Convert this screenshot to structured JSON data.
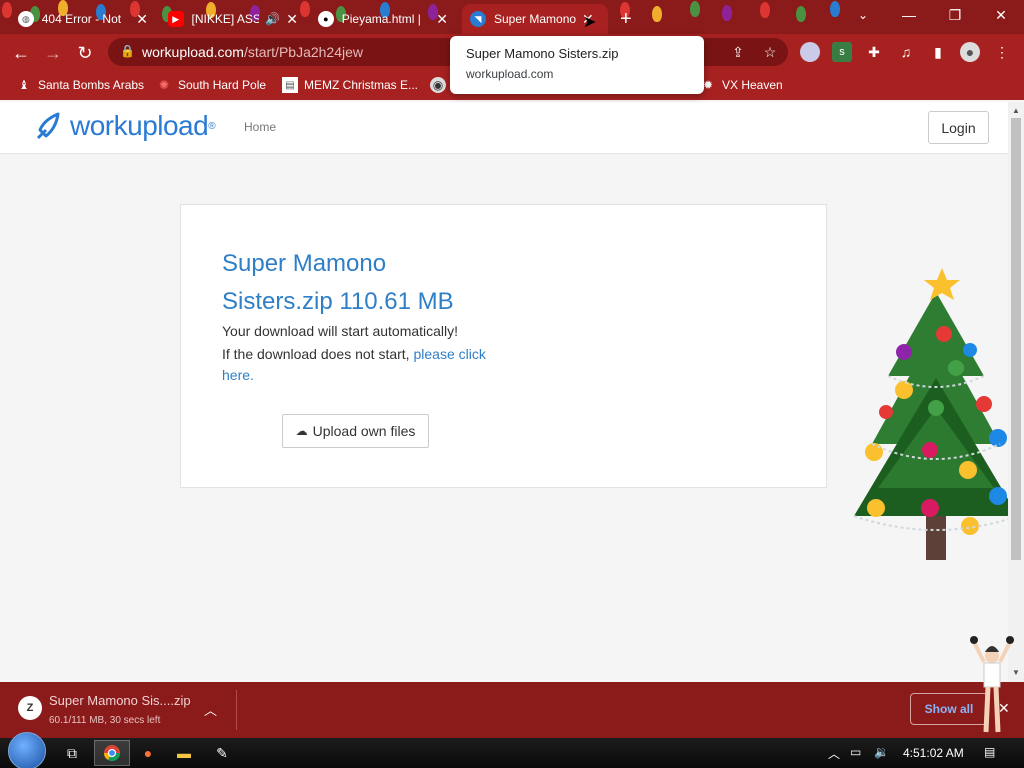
{
  "browser": {
    "tabs": [
      {
        "title": "404 Error - Not",
        "favicon": "chrome-globe-icon"
      },
      {
        "title": "[NIKKE] ASS",
        "favicon": "youtube-icon",
        "audio": "speaker-icon"
      },
      {
        "title": "Pieyama.html |",
        "favicon": "panda-icon"
      },
      {
        "title": "Super Mamono",
        "favicon": "workupload-icon",
        "active": true
      }
    ],
    "new_tab": "+",
    "url": {
      "host": "workupload.com",
      "path": "/start/PbJa2h24jew"
    },
    "bookmarks": [
      {
        "label": "Santa Bombs Arabs",
        "icon": "santa-icon"
      },
      {
        "label": "South Hard Pole",
        "icon": "snowflake-icon"
      },
      {
        "label": "MEMZ Christmas E...",
        "icon": "document-icon"
      },
      {
        "label": "VX Heaven",
        "icon": "virus-icon"
      }
    ],
    "tooltip": {
      "title": "Super Mamono Sisters.zip",
      "host": "workupload.com"
    },
    "colors": {
      "frame": "#8b1a1a",
      "toolbar": "#a82121",
      "omnibox": "#7a1414"
    }
  },
  "site": {
    "logo": "workupload",
    "logo_mark": "®",
    "nav_home": "Home",
    "login": "Login"
  },
  "download_card": {
    "title": "Super Mamono Sisters.zip 110.61 MB",
    "line1": "Your download will start automatically!",
    "line2_prefix": "If the download does not start, ",
    "line2_link": "please click here.",
    "upload_button": "Upload own files",
    "accent": "#2f7fc7"
  },
  "download_bar": {
    "filename": "Super Mamono Sis....zip",
    "progress": "60.1/111 MB, 30 secs left",
    "show_all": "Show all"
  },
  "taskbar": {
    "clock": "4:51:02 AM"
  }
}
